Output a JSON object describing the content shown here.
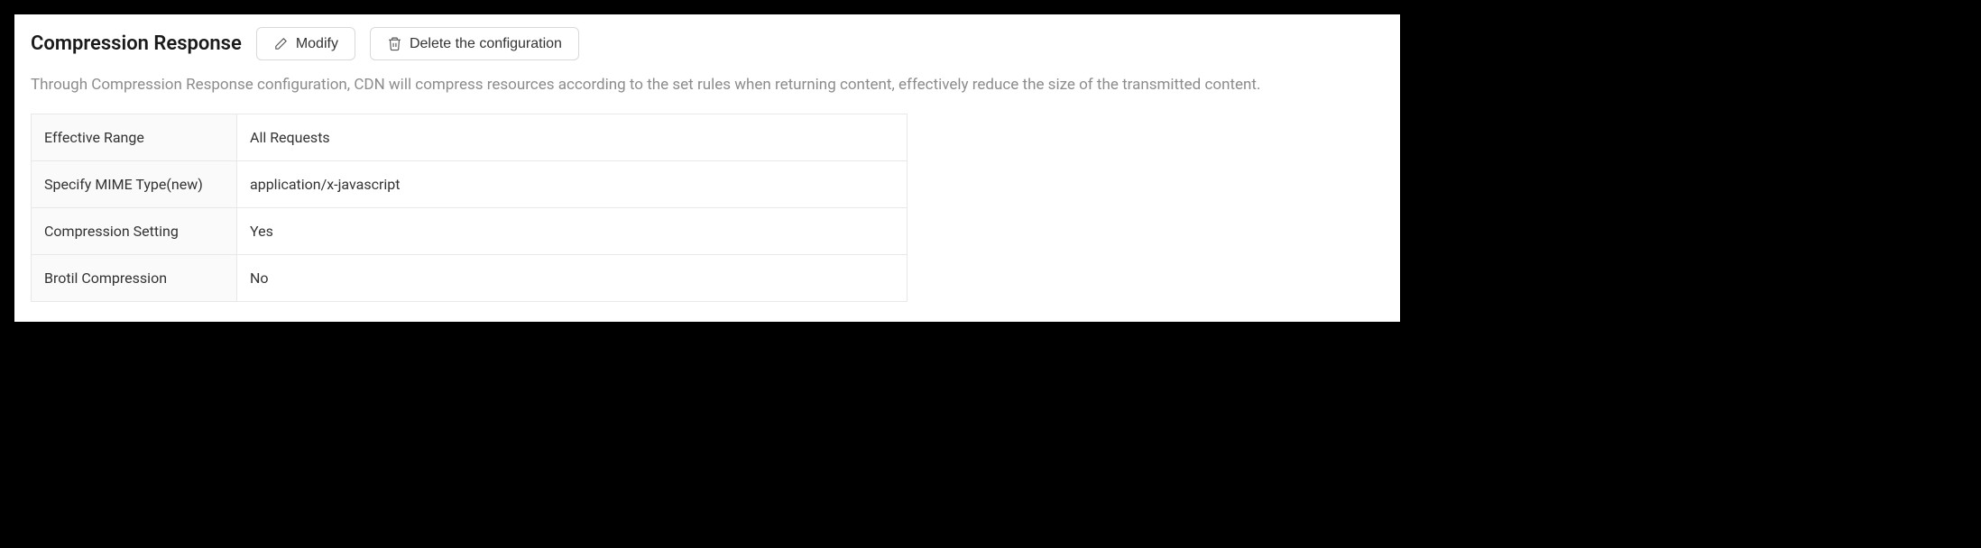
{
  "section": {
    "title": "Compression Response",
    "modify_label": "Modify",
    "delete_label": "Delete the configuration",
    "description": "Through Compression Response configuration, CDN will compress resources according to the set rules when returning content, effectively reduce the size of the transmitted content."
  },
  "table": {
    "rows": [
      {
        "label": "Effective Range",
        "value": "All Requests"
      },
      {
        "label": "Specify MIME Type(new)",
        "value": "application/x-javascript"
      },
      {
        "label": "Compression Setting",
        "value": "Yes"
      },
      {
        "label": "Brotil Compression",
        "value": "No"
      }
    ]
  }
}
